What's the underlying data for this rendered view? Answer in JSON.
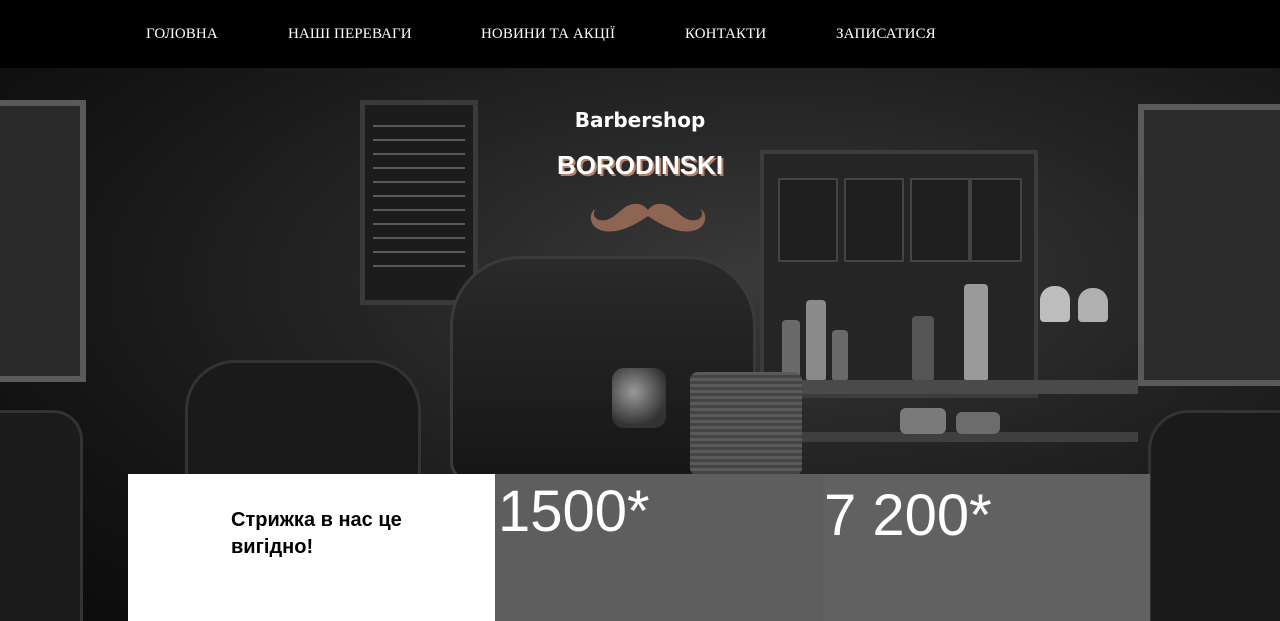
{
  "nav": {
    "items": [
      {
        "label": "ГОЛОВНА"
      },
      {
        "label": "НАШІ ПЕРЕВАГИ"
      },
      {
        "label": "НОВИНИ ТА АКЦІЇ"
      },
      {
        "label": "КОНТАКТИ"
      },
      {
        "label": "ЗАПИСАТИСЯ"
      }
    ]
  },
  "hero": {
    "logo_line1": "Barbershop",
    "logo_line2": "BORODINSKI",
    "mustache_icon": "mustache-icon",
    "logo_shadow_color": "#b6806a",
    "mustache_color": "#8d6552"
  },
  "offer": {
    "headline": "Стрижка в нас це вигідно!",
    "price_1": "1500*",
    "price_2": "7 200*"
  }
}
